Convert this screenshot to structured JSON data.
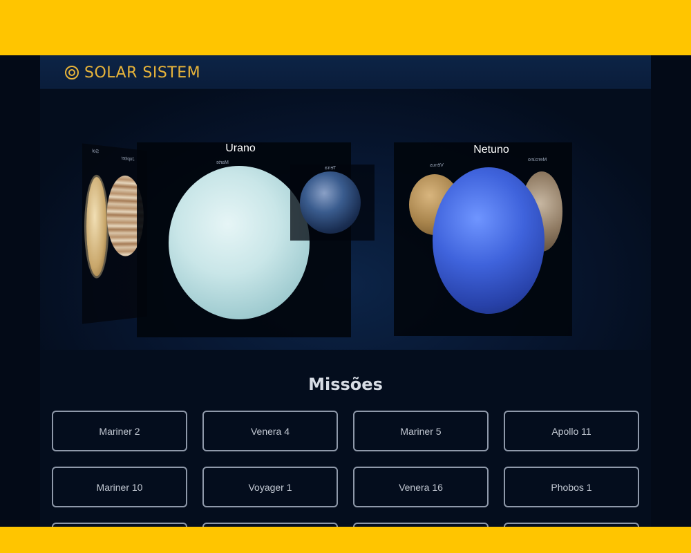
{
  "header": {
    "logo_text": "SOLAR SISTEM"
  },
  "carousel": {
    "left_card": {
      "labels": [
        "Sol",
        "Júpiter"
      ]
    },
    "center_card": {
      "title": "Urano",
      "labels": [
        "Marte",
        "Terra"
      ]
    },
    "right_card": {
      "title": "Netuno",
      "labels": [
        "Vênus",
        "Mercúrio"
      ]
    }
  },
  "missions": {
    "title": "Missões",
    "items": [
      "Mariner 2",
      "Venera 4",
      "Mariner 5",
      "Apollo 11",
      "Mariner 10",
      "Voyager 1",
      "Venera 16",
      "Phobos 1",
      "",
      "",
      "",
      ""
    ]
  }
}
